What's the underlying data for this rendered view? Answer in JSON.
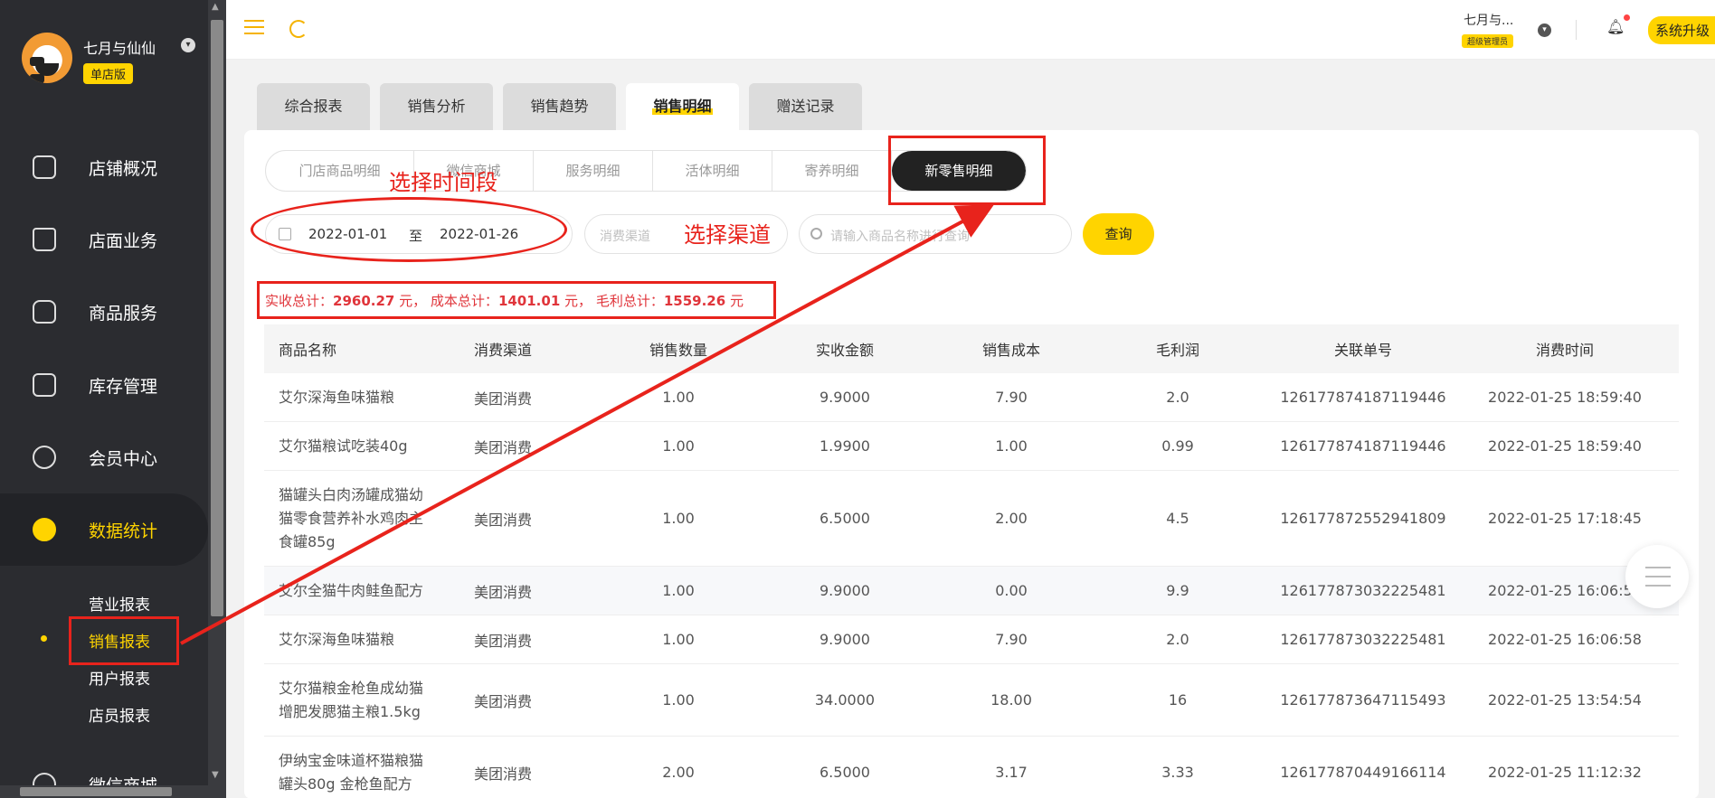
{
  "sidebar": {
    "profile": {
      "name": "七月与仙仙",
      "badge": "单店版"
    },
    "nav": [
      {
        "label": "店铺概况",
        "icon": "monitor-icon"
      },
      {
        "label": "店面业务",
        "icon": "store-icon"
      },
      {
        "label": "商品服务",
        "icon": "bag-icon"
      },
      {
        "label": "库存管理",
        "icon": "inventory-icon"
      },
      {
        "label": "会员中心",
        "icon": "member-icon"
      },
      {
        "label": "数据统计",
        "icon": "chart-icon"
      },
      {
        "label": "微信商城",
        "icon": "wechat-icon"
      }
    ],
    "sub": [
      "营业报表",
      "销售报表",
      "用户报表",
      "店员报表"
    ]
  },
  "topbar": {
    "user_name": "七月与...",
    "user_role": "超级管理员",
    "upgrade_label": "系统升级"
  },
  "tabs": [
    "综合报表",
    "销售分析",
    "销售趋势",
    "销售明细",
    "赠送记录"
  ],
  "subtabs": [
    "门店商品明细",
    "微信商城",
    "服务明细",
    "活体明细",
    "寄养明细",
    "新零售明细"
  ],
  "filters": {
    "date_start": "2022-01-01",
    "date_sep": "至",
    "date_end": "2022-01-26",
    "channel_placeholder": "消费渠道",
    "search_placeholder": "请输入商品名称进行查询",
    "query_label": "查询"
  },
  "totals": {
    "paid_label": "实收总计：",
    "paid_value": "2960.27",
    "unit1": "元，",
    "cost_label": "成本总计：",
    "cost_value": "1401.01",
    "unit2": "元，",
    "profit_label": "毛利总计：",
    "profit_value": "1559.26",
    "unit3": "元"
  },
  "table": {
    "headers": [
      "商品名称",
      "消费渠道",
      "销售数量",
      "实收金额",
      "销售成本",
      "毛利润",
      "关联单号",
      "消费时间"
    ],
    "rows": [
      {
        "name": [
          "艾尔深海鱼味猫粮"
        ],
        "channel": "美团消费",
        "qty": "1.00",
        "paid": "9.9000",
        "cost": "7.90",
        "profit": "2.0",
        "order": "126177874187119446",
        "time": "2022-01-25 18:59:40"
      },
      {
        "name": [
          "艾尔猫粮试吃装40g"
        ],
        "channel": "美团消费",
        "qty": "1.00",
        "paid": "1.9900",
        "cost": "1.00",
        "profit": "0.99",
        "order": "126177874187119446",
        "time": "2022-01-25 18:59:40"
      },
      {
        "name": [
          "猫罐头白肉汤罐成猫幼",
          "猫零食营养补水鸡肉主",
          "食罐85g"
        ],
        "channel": "美团消费",
        "qty": "1.00",
        "paid": "6.5000",
        "cost": "2.00",
        "profit": "4.5",
        "order": "126177872552941809",
        "time": "2022-01-25 17:18:45"
      },
      {
        "name": [
          "艾尔全猫牛肉鲑鱼配方"
        ],
        "channel": "美团消费",
        "qty": "1.00",
        "paid": "9.9000",
        "cost": "0.00",
        "profit": "9.9",
        "order": "126177873032225481",
        "time": "2022-01-25 16:06:58"
      },
      {
        "name": [
          "艾尔深海鱼味猫粮"
        ],
        "channel": "美团消费",
        "qty": "1.00",
        "paid": "9.9000",
        "cost": "7.90",
        "profit": "2.0",
        "order": "126177873032225481",
        "time": "2022-01-25 16:06:58"
      },
      {
        "name": [
          "艾尔猫粮金枪鱼成幼猫",
          "增肥发腮猫主粮1.5kg"
        ],
        "channel": "美团消费",
        "qty": "1.00",
        "paid": "34.0000",
        "cost": "18.00",
        "profit": "16",
        "order": "126177873647115493",
        "time": "2022-01-25 13:54:54"
      },
      {
        "name": [
          "伊纳宝金味道杯猫粮猫",
          "罐头80g 金枪鱼配方"
        ],
        "channel": "美团消费",
        "qty": "2.00",
        "paid": "6.5000",
        "cost": "3.17",
        "profit": "3.33",
        "order": "126177870449166114",
        "time": "2022-01-25 11:12:32"
      }
    ]
  },
  "annotations": {
    "time_label": "选择时间段",
    "channel_label": "选择渠道"
  },
  "colors": {
    "accent": "#ffd400",
    "sidebar_bg": "#2b2c30",
    "annotation_red": "#e8231c",
    "totals_red": "#e0353b"
  }
}
